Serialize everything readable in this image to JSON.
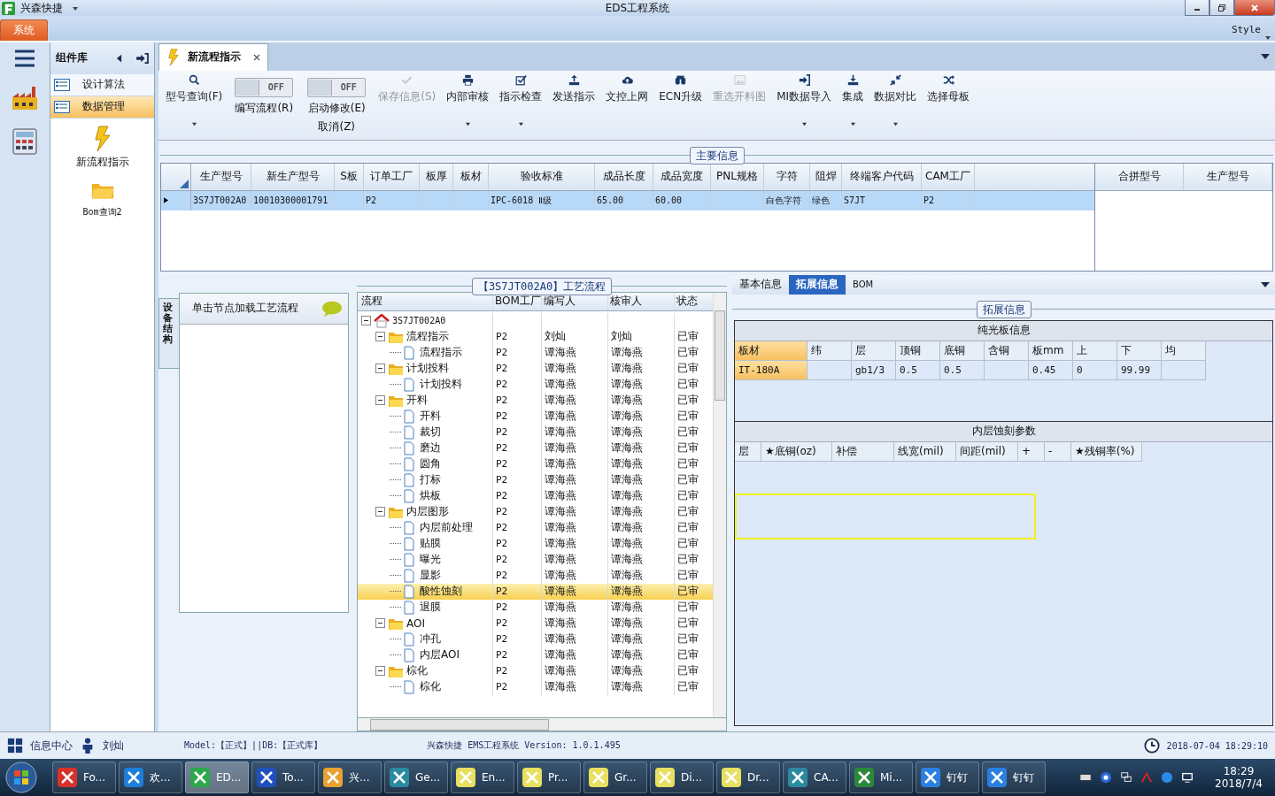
{
  "window": {
    "app_name": "兴森快捷",
    "title": "EDS工程系统"
  },
  "ribbon": {
    "tabs": [
      {
        "label": "系统",
        "selected": true
      }
    ],
    "style_label": "Style"
  },
  "component_panel": {
    "title": "组件库",
    "items": [
      {
        "label": "设计算法",
        "selected": false
      },
      {
        "label": "数据管理",
        "selected": true
      }
    ],
    "tools": [
      {
        "label": "新流程指示"
      },
      {
        "label": "Bom查询2"
      }
    ]
  },
  "document_tabs": [
    {
      "label": "新流程指示",
      "selected": true
    }
  ],
  "toolbar": [
    {
      "kind": "button",
      "label": "型号查询(F)",
      "disabled": false,
      "dropdown": true
    },
    {
      "kind": "toggle",
      "label": "编写流程(R)",
      "state": "OFF",
      "on": false
    },
    {
      "kind": "toggle",
      "label": "启动修改(E)",
      "sublabel": "取消(Z)",
      "state": "OFF",
      "on": false
    },
    {
      "kind": "button",
      "label": "保存信息(S)",
      "disabled": true,
      "dropdown": false
    },
    {
      "kind": "button",
      "label": "内部审核",
      "disabled": false,
      "dropdown": true
    },
    {
      "kind": "button",
      "label": "指示检查",
      "disabled": false,
      "dropdown": true
    },
    {
      "kind": "button",
      "label": "发送指示",
      "disabled": false,
      "dropdown": false
    },
    {
      "kind": "button",
      "label": "文控上网",
      "disabled": false,
      "dropdown": false
    },
    {
      "kind": "button",
      "label": "ECN升级",
      "disabled": false,
      "dropdown": false
    },
    {
      "kind": "button",
      "label": "重选开料图",
      "disabled": true,
      "dropdown": false
    },
    {
      "kind": "button",
      "label": "MI数据导入",
      "disabled": false,
      "dropdown": true
    },
    {
      "kind": "button",
      "label": "集成",
      "disabled": false,
      "dropdown": true
    },
    {
      "kind": "button",
      "label": "数据对比",
      "disabled": false,
      "dropdown": true
    },
    {
      "kind": "button",
      "label": "选择母板",
      "disabled": false,
      "dropdown": false
    }
  ],
  "main_info": {
    "title": "主要信息",
    "columns": [
      "生产型号",
      "新生产型号",
      "S板",
      "订单工厂",
      "板厚",
      "板材",
      "验收标准",
      "成品长度",
      "成品宽度",
      "PNL规格",
      "字符",
      "阻焊",
      "终端客户代码",
      "CAM工厂"
    ],
    "rows": [
      {
        "selected": true,
        "cells": [
          "3S7JT002A0",
          "10010300001791",
          null,
          "P2",
          null,
          null,
          "IPC-6018 Ⅱ级",
          "65.00",
          "60.00",
          null,
          "白色字符",
          "绿色",
          "S7JT",
          "P2"
        ]
      }
    ],
    "side_columns": [
      "合拼型号",
      "生产型号"
    ]
  },
  "device_panel": {
    "tab": "设备结构",
    "hint": "单击节点加载工艺流程"
  },
  "process_tree": {
    "title": "【3S7JT002A0】工艺流程",
    "columns": [
      "流程",
      "BOM工厂",
      "编写人",
      "核审人",
      "状态"
    ],
    "nodes": [
      {
        "kind": "root",
        "label": "3S7JT002A0",
        "expanded": true,
        "selected": false,
        "children": [
          {
            "kind": "folder",
            "label": "流程指示",
            "bom": "P2",
            "writer": "刘灿",
            "reviewer": "刘灿",
            "status": "已审",
            "expanded": true,
            "selected": false,
            "children": [
              {
                "kind": "step",
                "label": "流程指示",
                "bom": "P2",
                "writer": "谭海燕",
                "reviewer": "谭海燕",
                "status": "已审",
                "selected": false
              }
            ]
          },
          {
            "kind": "folder",
            "label": "计划投料",
            "bom": "P2",
            "writer": "谭海燕",
            "reviewer": "谭海燕",
            "status": "已审",
            "expanded": true,
            "selected": false,
            "children": [
              {
                "kind": "step",
                "label": "计划投料",
                "bom": "P2",
                "writer": "谭海燕",
                "reviewer": "谭海燕",
                "status": "已审",
                "selected": false
              }
            ]
          },
          {
            "kind": "folder",
            "label": "开料",
            "bom": "P2",
            "writer": "谭海燕",
            "reviewer": "谭海燕",
            "status": "已审",
            "expanded": true,
            "selected": false,
            "children": [
              {
                "kind": "step",
                "label": "开料",
                "bom": "P2",
                "writer": "谭海燕",
                "reviewer": "谭海燕",
                "status": "已审",
                "selected": false
              },
              {
                "kind": "step",
                "label": "裁切",
                "bom": "P2",
                "writer": "谭海燕",
                "reviewer": "谭海燕",
                "status": "已审",
                "selected": false
              },
              {
                "kind": "step",
                "label": "磨边",
                "bom": "P2",
                "writer": "谭海燕",
                "reviewer": "谭海燕",
                "status": "已审",
                "selected": false
              },
              {
                "kind": "step",
                "label": "圆角",
                "bom": "P2",
                "writer": "谭海燕",
                "reviewer": "谭海燕",
                "status": "已审",
                "selected": false
              },
              {
                "kind": "step",
                "label": "打标",
                "bom": "P2",
                "writer": "谭海燕",
                "reviewer": "谭海燕",
                "status": "已审",
                "selected": false
              },
              {
                "kind": "step",
                "label": "烘板",
                "bom": "P2",
                "writer": "谭海燕",
                "reviewer": "谭海燕",
                "status": "已审",
                "selected": false
              }
            ]
          },
          {
            "kind": "folder",
            "label": "内层图形",
            "bom": "P2",
            "writer": "谭海燕",
            "reviewer": "谭海燕",
            "status": "已审",
            "expanded": true,
            "selected": false,
            "children": [
              {
                "kind": "step",
                "label": "内层前处理",
                "bom": "P2",
                "writer": "谭海燕",
                "reviewer": "谭海燕",
                "status": "已审",
                "selected": false
              },
              {
                "kind": "step",
                "label": "贴膜",
                "bom": "P2",
                "writer": "谭海燕",
                "reviewer": "谭海燕",
                "status": "已审",
                "selected": false
              },
              {
                "kind": "step",
                "label": "曝光",
                "bom": "P2",
                "writer": "谭海燕",
                "reviewer": "谭海燕",
                "status": "已审",
                "selected": false
              },
              {
                "kind": "step",
                "label": "显影",
                "bom": "P2",
                "writer": "谭海燕",
                "reviewer": "谭海燕",
                "status": "已审",
                "selected": false
              },
              {
                "kind": "step",
                "label": "酸性蚀刻",
                "bom": "P2",
                "writer": "谭海燕",
                "reviewer": "谭海燕",
                "status": "已审",
                "selected": true
              },
              {
                "kind": "step",
                "label": "退膜",
                "bom": "P2",
                "writer": "谭海燕",
                "reviewer": "谭海燕",
                "status": "已审",
                "selected": false
              }
            ]
          },
          {
            "kind": "folder",
            "label": "AOI",
            "bom": "P2",
            "writer": "谭海燕",
            "reviewer": "谭海燕",
            "status": "已审",
            "expanded": true,
            "selected": false,
            "children": [
              {
                "kind": "step",
                "label": "冲孔",
                "bom": "P2",
                "writer": "谭海燕",
                "reviewer": "谭海燕",
                "status": "已审",
                "selected": false
              },
              {
                "kind": "step",
                "label": "内层AOI",
                "bom": "P2",
                "writer": "谭海燕",
                "reviewer": "谭海燕",
                "status": "已审",
                "selected": false
              }
            ]
          },
          {
            "kind": "folder",
            "label": "棕化",
            "bom": "P2",
            "writer": "谭海燕",
            "reviewer": "谭海燕",
            "status": "已审",
            "expanded": true,
            "selected": false,
            "children": [
              {
                "kind": "step",
                "label": "棕化",
                "bom": "P2",
                "writer": "谭海燕",
                "reviewer": "谭海燕",
                "status": "已审",
                "selected": false
              }
            ]
          }
        ]
      }
    ]
  },
  "detail_panel": {
    "tabs": [
      {
        "label": "基本信息",
        "selected": false
      },
      {
        "label": "拓展信息",
        "selected": true
      },
      {
        "label": "BOM",
        "selected": false
      }
    ],
    "group_title": "拓展信息",
    "plain_board": {
      "title": "纯光板信息",
      "columns": [
        "板材",
        "纬",
        "层",
        "顶铜",
        "底铜",
        "含铜",
        "板mm",
        "上",
        "下",
        "均"
      ],
      "rows": [
        {
          "cells": [
            "IT-180A",
            null,
            "gb1/3",
            "0.5",
            "0.5",
            null,
            "0.45",
            "0",
            "99.99",
            null
          ]
        }
      ]
    },
    "etch_params": {
      "title": "内层蚀刻参数",
      "columns": [
        "层",
        "★底铜(oz)",
        "补偿",
        "线宽(mil)",
        "间距(mil)",
        "+",
        "-",
        "★残铜率(%)"
      ]
    }
  },
  "status_bar": {
    "info_center": "信息中心",
    "user": "刘灿",
    "model": "Model:【正式】||DB:【正式库】",
    "product": "兴森快捷 EMS工程系统 Version: 1.0.1.495",
    "datetime": "2018-07-04 18:29:10"
  },
  "taskbar": {
    "items": [
      {
        "label": "Fo...",
        "selected": false
      },
      {
        "label": "欢...",
        "selected": false
      },
      {
        "label": "ED...",
        "selected": true
      },
      {
        "label": "To...",
        "selected": false
      },
      {
        "label": "兴...",
        "selected": false
      },
      {
        "label": "Ge...",
        "selected": false
      },
      {
        "label": "En...",
        "selected": false
      },
      {
        "label": "Pr...",
        "selected": false
      },
      {
        "label": "Gr...",
        "selected": false
      },
      {
        "label": "Di...",
        "selected": false
      },
      {
        "label": "Dr...",
        "selected": false
      },
      {
        "label": "CA...",
        "selected": false
      },
      {
        "label": "Mi...",
        "selected": false
      },
      {
        "label": "钉钉",
        "selected": false
      },
      {
        "label": "钉钉",
        "selected": false
      }
    ],
    "time": "18:29",
    "date": "2018/7/4"
  }
}
